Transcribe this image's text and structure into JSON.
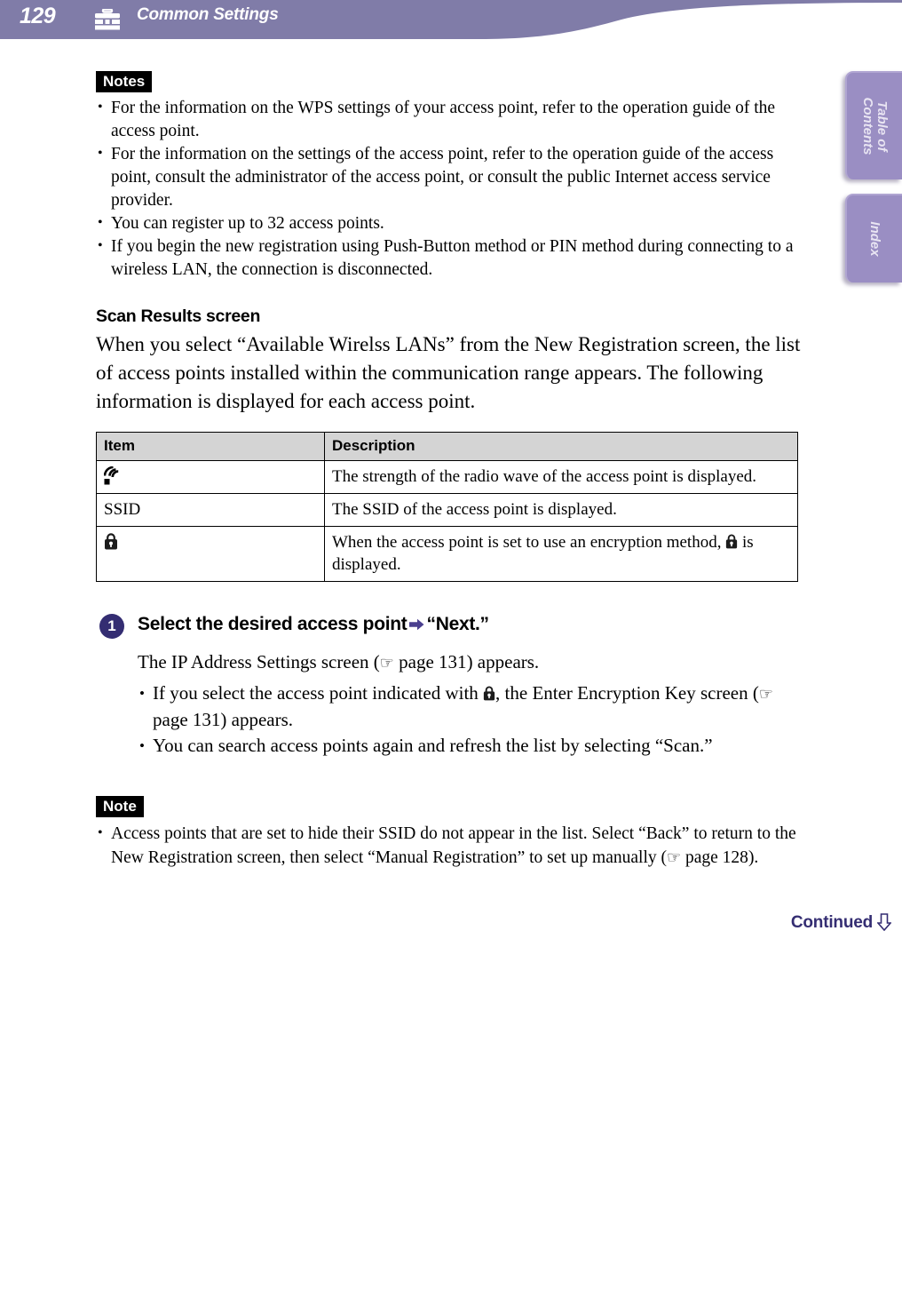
{
  "header": {
    "page_number": "129",
    "icon": "toolbox-icon",
    "title": "Common Settings",
    "bar_color": "#807ca8"
  },
  "side_tabs": [
    {
      "label": "Table of\nContents",
      "name": "table-of-contents"
    },
    {
      "label": "Index",
      "name": "index"
    }
  ],
  "notes_top": {
    "badge": "Notes",
    "items": [
      "For the information on the WPS settings of your access point, refer to the operation guide of the access point.",
      "For the information on the settings of the access point, refer to the operation guide of the access point, consult the administrator of the access point, or consult the public Internet access service provider.",
      "You can register up to 32 access points.",
      "If you begin the new registration using Push-Button method or PIN method during connecting to a wireless LAN, the connection is disconnected."
    ]
  },
  "section": {
    "heading": "Scan Results screen",
    "paragraph": "When you select “Available Wirelss LANs” from the New Registration screen, the list of access points installed within the communication range appears. The following information is displayed for each access point."
  },
  "table": {
    "headers": [
      "Item",
      "Description"
    ],
    "rows": [
      {
        "item_icon": "signal-strength-icon",
        "item_text": "",
        "description": "The strength of the radio wave of the access point is displayed."
      },
      {
        "item_icon": "",
        "item_text": "SSID",
        "description": "The SSID of the access point is displayed."
      },
      {
        "item_icon": "lock-icon",
        "item_text": "",
        "description_before": "When the access point is set to use an encryption method, ",
        "description_after": " is displayed."
      }
    ]
  },
  "step": {
    "number": "1",
    "title_before": "Select the desired access point",
    "arrow": "arrow-right-icon",
    "title_after": "“Next.”",
    "lead_before": "The IP Address Settings screen (",
    "lead_ref": "page 131",
    "lead_after": ") appears.",
    "bullets": [
      {
        "before": "If you select the access point indicated with ",
        "icon": "lock-icon",
        "middle": ", the Enter Encryption Key screen (",
        "ref": "page 131",
        "after": ") appears."
      },
      {
        "before": "You can search access points again and refresh the list by selecting “Scan.”",
        "icon": "",
        "middle": "",
        "ref": "",
        "after": ""
      }
    ]
  },
  "note_bottom": {
    "badge": "Note",
    "item_before": "Access points that are set to hide their SSID do not appear in the list. Select “Back” to return to the New Registration screen, then select “Manual Registration” to set up manually (",
    "item_ref": "page 128",
    "item_after": ")."
  },
  "footer": {
    "continued": "Continued",
    "arrow": "arrow-down-icon",
    "color": "#342d72"
  }
}
